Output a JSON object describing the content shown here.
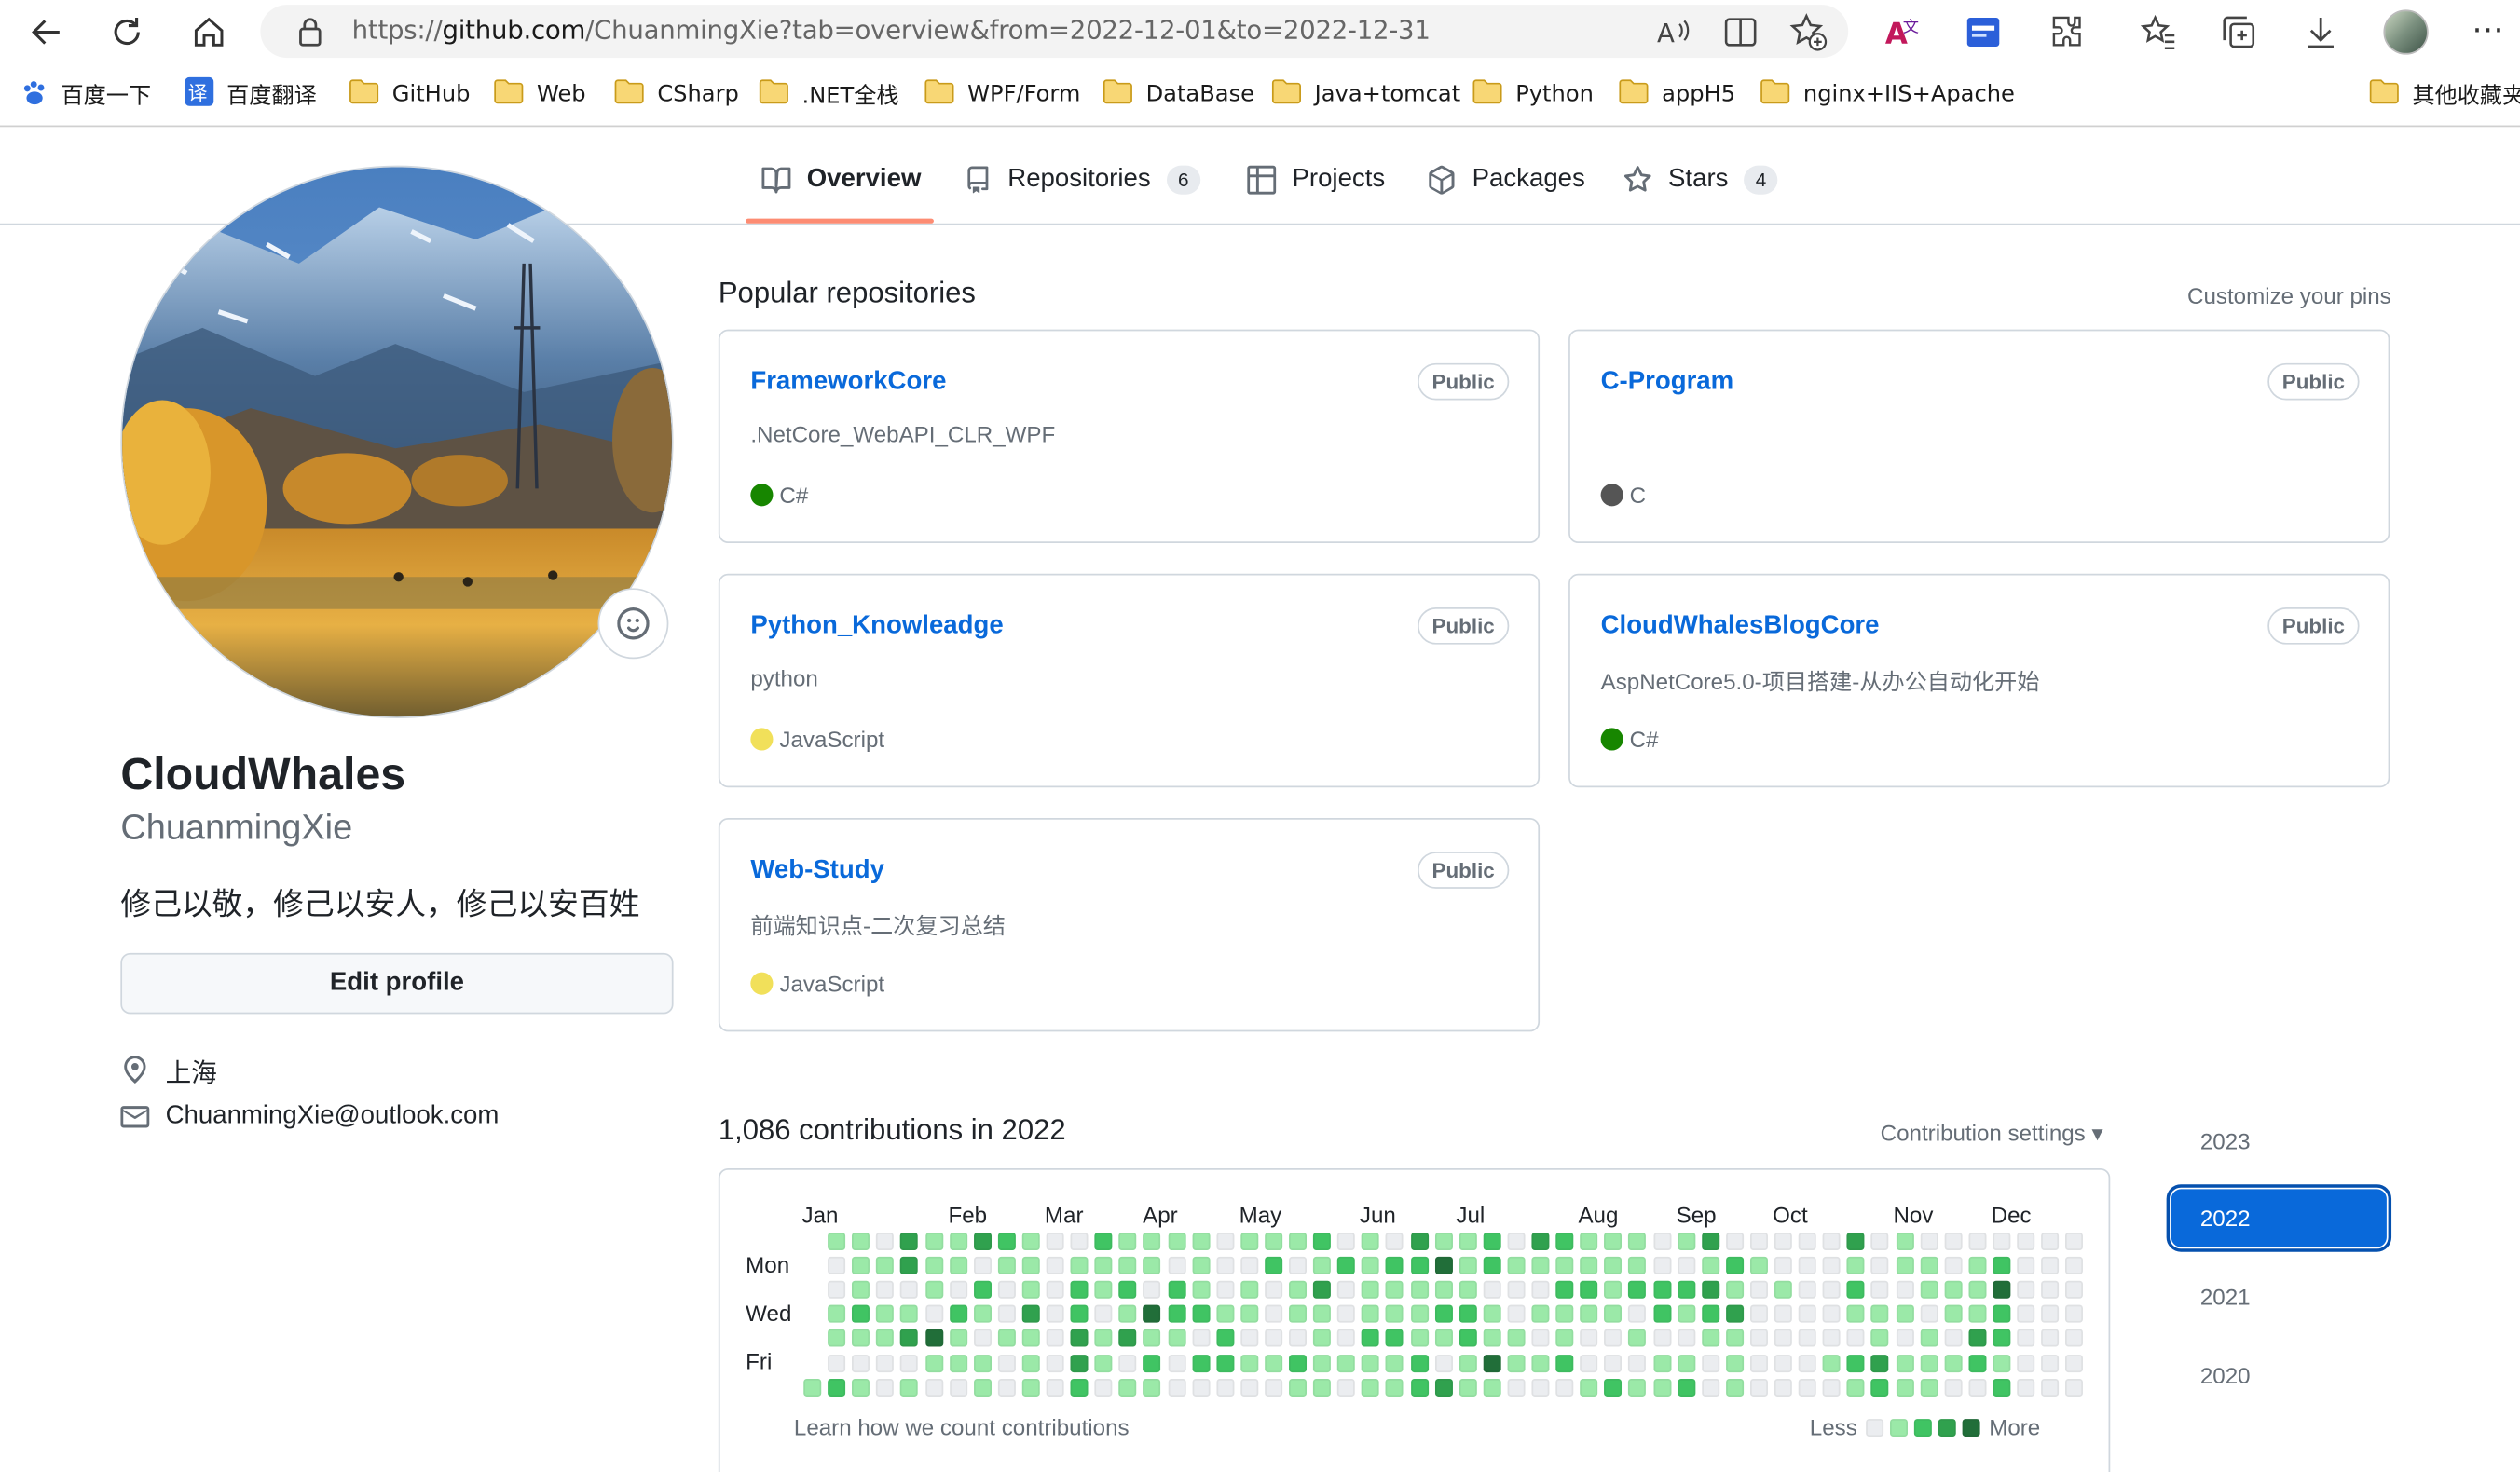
{
  "browser": {
    "url_prefix": "https://",
    "url_host": "github.com",
    "url_path": "/ChuanmingXie?tab=overview&from=2022-12-01&to=2022-12-31",
    "bookmarks": [
      "百度一下",
      "百度翻译",
      "GitHub",
      "Web",
      "CSharp",
      ".NET全栈",
      "WPF/Form",
      "DataBase",
      "Java+tomcat",
      "Python",
      "appH5",
      "nginx+IIS+Apache"
    ],
    "other_bookmarks": "其他收藏夹"
  },
  "tabs": [
    {
      "label": "Overview",
      "icon": "book-icon",
      "count": ""
    },
    {
      "label": "Repositories",
      "icon": "repo-icon",
      "count": "6"
    },
    {
      "label": "Projects",
      "icon": "table-icon",
      "count": ""
    },
    {
      "label": "Packages",
      "icon": "package-icon",
      "count": ""
    },
    {
      "label": "Stars",
      "icon": "star-icon",
      "count": "4"
    }
  ],
  "profile": {
    "name": "CloudWhales",
    "login": "ChuanmingXie",
    "bio": "修己以敬，修己以安人，修己以安百姓",
    "edit_label": "Edit profile",
    "location": "上海",
    "email": "ChuanmingXie@outlook.com"
  },
  "popular": {
    "title": "Popular repositories",
    "customize": "Customize your pins",
    "repos": [
      {
        "name": "FrameworkCore",
        "visibility": "Public",
        "description": ".NetCore_WebAPI_CLR_WPF",
        "language": "C#",
        "lang_color": "#178600"
      },
      {
        "name": "C-Program",
        "visibility": "Public",
        "description": "",
        "language": "C",
        "lang_color": "#555555"
      },
      {
        "name": "Python_Knowleadge",
        "visibility": "Public",
        "description": "python",
        "language": "JavaScript",
        "lang_color": "#f1e05a"
      },
      {
        "name": "CloudWhalesBlogCore",
        "visibility": "Public",
        "description": "AspNetCore5.0-项目搭建-从办公自动化开始",
        "language": "C#",
        "lang_color": "#178600"
      },
      {
        "name": "Web-Study",
        "visibility": "Public",
        "description": "前端知识点-二次复习总结",
        "language": "JavaScript",
        "lang_color": "#f1e05a"
      }
    ]
  },
  "contributions": {
    "title": "1,086 contributions in 2022",
    "settings": "Contribution settings ▾",
    "months": [
      "Jan",
      "Feb",
      "Mar",
      "Apr",
      "May",
      "Jun",
      "Jul",
      "Aug",
      "Sep",
      "Oct",
      "Nov",
      "Dec"
    ],
    "day_labels": [
      "Mon",
      "Wed",
      "Fri"
    ],
    "learn": "Learn how we count contributions",
    "less": "Less",
    "more": "More",
    "level_colors": [
      "#ebedf0",
      "#9be9a8",
      "#40c463",
      "#30a14e",
      "#216e39"
    ],
    "years": [
      "2023",
      "2022",
      "2021",
      "2020"
    ],
    "selected_year": "2022"
  }
}
